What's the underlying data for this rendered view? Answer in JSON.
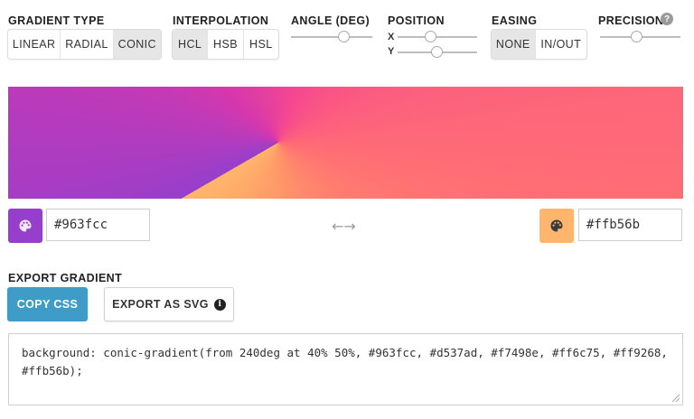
{
  "gradient_type": {
    "label": "GRADIENT TYPE",
    "options": [
      "LINEAR",
      "RADIAL",
      "CONIC"
    ],
    "selected": "CONIC"
  },
  "interpolation": {
    "label": "INTERPOLATION",
    "options": [
      "HCL",
      "HSB",
      "HSL"
    ],
    "selected": "HCL"
  },
  "angle": {
    "label": "ANGLE (DEG)",
    "value": 240
  },
  "position": {
    "label": "POSITION",
    "x_label": "X",
    "y_label": "Y",
    "x": 40,
    "y": 50
  },
  "easing": {
    "label": "EASING",
    "options": [
      "NONE",
      "IN/OUT"
    ],
    "selected": "NONE"
  },
  "precision": {
    "label": "PRECISION",
    "help_icon": "question-circle-icon",
    "level": 0.45
  },
  "colors": {
    "start": "#963fcc",
    "end": "#ffb56b",
    "stops": [
      "#963fcc",
      "#d537ad",
      "#f7498e",
      "#ff6c75",
      "#ff9268",
      "#ffb56b"
    ],
    "start_swatch_icon": "palette-icon",
    "end_swatch_icon": "palette-icon",
    "swap_icon": "swap-arrows-icon"
  },
  "export": {
    "label": "EXPORT GRADIENT",
    "copy_button": "COPY CSS",
    "svg_button": "EXPORT AS SVG",
    "svg_info_icon": "info-icon",
    "copy_color": "#3e9cc6",
    "css_text": "background: conic-gradient(from 240deg at 40% 50%, #963fcc, #d537ad, #f7498e, #ff6c75, #ff9268, #ffb56b);"
  }
}
